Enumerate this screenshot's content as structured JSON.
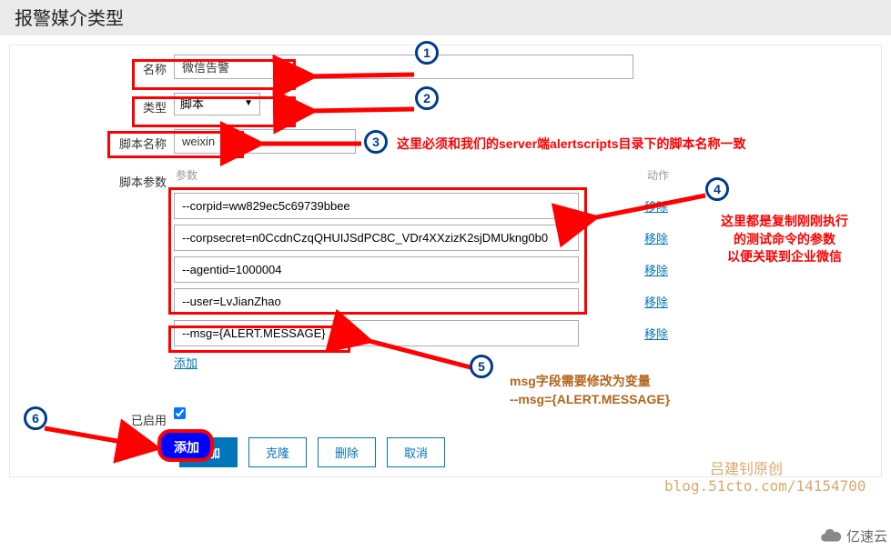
{
  "page_title": "报警媒介类型",
  "labels": {
    "name": "名称",
    "type": "类型",
    "script_name": "脚本名称",
    "script_params": "脚本参数",
    "col_param": "参数",
    "col_action": "动作",
    "enabled": "已启用"
  },
  "values": {
    "name": "微信告警",
    "type_selected": "脚本",
    "script_name": "weixin",
    "enabled_checked": true
  },
  "params": [
    {
      "value": "--corpid=ww829ec5c69739bbee",
      "action": "移除"
    },
    {
      "value": "--corpsecret=n0CcdnCzqQHUIJSdPC8C_VDr4XXzizK2sjDMUkng0b0",
      "action": "移除"
    },
    {
      "value": "--agentid=1000004",
      "action": "移除"
    },
    {
      "value": "--user=LvJianZhao",
      "action": "移除"
    },
    {
      "value": "--msg={ALERT.MESSAGE}",
      "action": "移除"
    }
  ],
  "links": {
    "add_param": "添加"
  },
  "buttons": {
    "add": "添加",
    "clone": "克隆",
    "delete": "删除",
    "cancel": "取消"
  },
  "annotations": {
    "b1": "1",
    "b2": "2",
    "b3": "3",
    "b4": "4",
    "b5": "5",
    "b6": "6",
    "text3": "这里必须和我们的server端alertscripts目录下的脚本名称一致",
    "text4_l1": "这里都是复制刚刚执行",
    "text4_l2": "的测试命令的参数",
    "text4_l3": "以便关联到企业微信",
    "text5_l1": "msg字段需要修改为变量",
    "text5_l2": "--msg={ALERT.MESSAGE}"
  },
  "watermark": {
    "line1": "吕建钊原创",
    "line2": "blog.51cto.com/14154700",
    "logo": "亿速云"
  }
}
